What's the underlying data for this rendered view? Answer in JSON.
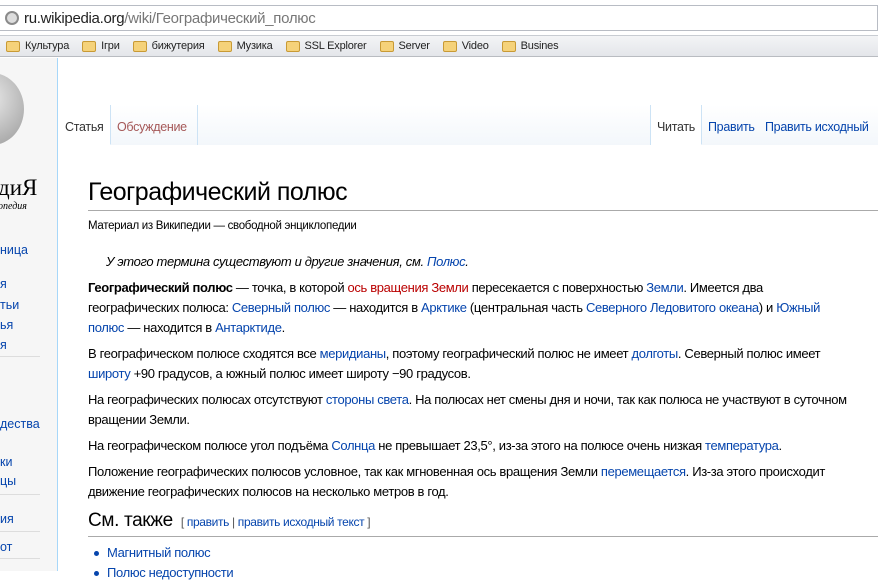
{
  "browser": {
    "url_host": "ru.wikipedia.org",
    "url_path": "/wiki/Географический_полюс",
    "bookmarks": [
      "Культура",
      "Ігри",
      "бижутерия",
      "Музика",
      "SSL Explorer",
      "Server",
      "Video",
      "Busines"
    ]
  },
  "sidebar": {
    "logo_title": "диЯ",
    "logo_subtitle": "опедия",
    "items": [
      "ница",
      "я",
      "тьи",
      "ья",
      "я",
      "дества",
      "ки",
      "цы",
      "ия",
      "от"
    ]
  },
  "tabs": {
    "left": [
      "Статья",
      "Обсуждение"
    ],
    "right": [
      "Читать",
      "Править",
      "Править исходный"
    ]
  },
  "article": {
    "title": "Географический полюс",
    "subtitle": "Материал из Википедии — свободной энциклопедии",
    "hatnote": [
      {
        "t": "У этого термина существуют и другие значения, см. "
      },
      {
        "t": "Полюс",
        "l": 1
      },
      {
        "t": "."
      }
    ],
    "paragraphs": [
      [
        {
          "t": "Географический полюс",
          "b": 1
        },
        {
          "t": " — точка, в которой "
        },
        {
          "t": "ось вращения Земли",
          "r": 1
        },
        {
          "t": " пересекается с поверхностью "
        },
        {
          "t": "Земли",
          "l": 1
        },
        {
          "t": ". Имеется два"
        },
        {
          "br": 1
        },
        {
          "t": "географических полюса: "
        },
        {
          "t": "Северный полюс",
          "l": 1
        },
        {
          "t": " — находится в "
        },
        {
          "t": "Арктике",
          "l": 1
        },
        {
          "t": " (центральная часть "
        },
        {
          "t": "Северного Ледовитого океана",
          "l": 1
        },
        {
          "t": ") и "
        },
        {
          "t": "Южный",
          "l": 1
        },
        {
          "br": 1
        },
        {
          "t": "полюс",
          "l": 1
        },
        {
          "t": " — находится в "
        },
        {
          "t": "Антарктиде",
          "l": 1
        },
        {
          "t": "."
        }
      ],
      [
        {
          "t": "В географическом полюсе сходятся все "
        },
        {
          "t": "меридианы",
          "l": 1
        },
        {
          "t": ", поэтому географический полюс не имеет "
        },
        {
          "t": "долготы",
          "l": 1
        },
        {
          "t": ". Северный полюс имеет"
        },
        {
          "br": 1
        },
        {
          "t": "широту",
          "l": 1
        },
        {
          "t": " +90 градусов, а южный полюс имеет широту −90 градусов."
        }
      ],
      [
        {
          "t": "На географических полюсах отсутствуют "
        },
        {
          "t": "стороны света",
          "l": 1
        },
        {
          "t": ". На полюсах нет смены дня и ночи, так как полюса не участвуют в суточном"
        },
        {
          "br": 1
        },
        {
          "t": "вращении Земли."
        }
      ],
      [
        {
          "t": "На географическом полюсе угол подъёма "
        },
        {
          "t": "Солнца",
          "l": 1
        },
        {
          "t": " не превышает 23,5°, из-за этого на полюсе очень низкая "
        },
        {
          "t": "температура",
          "l": 1
        },
        {
          "t": "."
        }
      ],
      [
        {
          "t": "Положение географических полюсов условное, так как мгновенная ось вращения Земли "
        },
        {
          "t": "перемещается",
          "l": 1
        },
        {
          "t": ". Из-за этого происходит"
        },
        {
          "br": 1
        },
        {
          "t": "движение географических полюсов на несколько метров в год."
        }
      ]
    ],
    "see_also": {
      "heading": "См. также",
      "edit": "править",
      "edit_source": "править исходный текст",
      "items": [
        "Магнитный полюс",
        "Полюс недоступности"
      ]
    }
  }
}
